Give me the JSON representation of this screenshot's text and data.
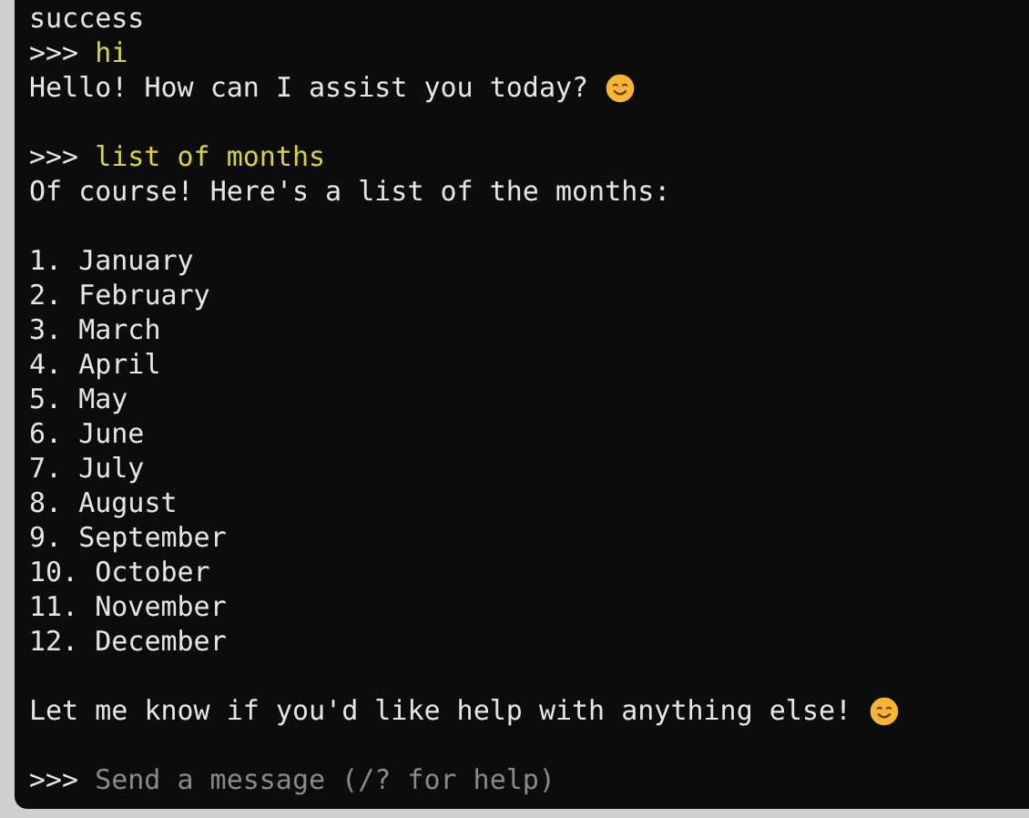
{
  "lines": [
    {
      "kind": "output",
      "text": "success"
    },
    {
      "kind": "prompt",
      "marker": ">>>",
      "text": "hi"
    },
    {
      "kind": "output",
      "text": "Hello! How can I assist you today?",
      "emoji": true
    },
    {
      "kind": "spacer"
    },
    {
      "kind": "prompt",
      "marker": ">>>",
      "text": "list of months"
    },
    {
      "kind": "output",
      "text": "Of course! Here's a list of the months:"
    },
    {
      "kind": "spacer"
    },
    {
      "kind": "output",
      "text": "1. January"
    },
    {
      "kind": "output",
      "text": "2. February"
    },
    {
      "kind": "output",
      "text": "3. March"
    },
    {
      "kind": "output",
      "text": "4. April"
    },
    {
      "kind": "output",
      "text": "5. May"
    },
    {
      "kind": "output",
      "text": "6. June"
    },
    {
      "kind": "output",
      "text": "7. July"
    },
    {
      "kind": "output",
      "text": "8. August"
    },
    {
      "kind": "output",
      "text": "9. September"
    },
    {
      "kind": "output",
      "text": "10. October"
    },
    {
      "kind": "output",
      "text": "11. November"
    },
    {
      "kind": "output",
      "text": "12. December"
    },
    {
      "kind": "spacer"
    },
    {
      "kind": "output",
      "text": "Let me know if you'd like help with anything else!",
      "emoji": true
    },
    {
      "kind": "spacer"
    }
  ],
  "input": {
    "marker": ">>>",
    "placeholder": "Send a message (/? for help)"
  }
}
